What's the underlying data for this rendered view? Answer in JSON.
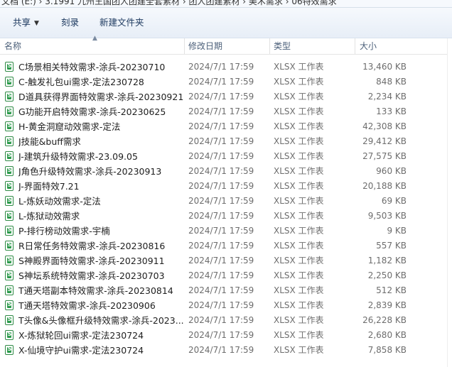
{
  "address": {
    "text": "文档 (E:) › 3.1991 九州王国团人团建全套素材 › 团人团建素材 › 美术需求 › 06特效需求"
  },
  "toolbar": {
    "share_label": "共享",
    "burn_label": "刻录",
    "new_folder_label": "新建文件夹"
  },
  "columns": {
    "name": "名称",
    "date": "修改日期",
    "type": "类型",
    "size": "大小"
  },
  "files": [
    {
      "name": "C场景相关特效需求-涂兵-20230710",
      "date": "2024/7/1 17:59",
      "type": "XLSX 工作表",
      "size": "13,460 KB"
    },
    {
      "name": "C-触发礼包ui需求-定法230728",
      "date": "2024/7/1 17:59",
      "type": "XLSX 工作表",
      "size": "848 KB"
    },
    {
      "name": "D道具获得界面特效需求-涂兵-20230921",
      "date": "2024/7/1 17:59",
      "type": "XLSX 工作表",
      "size": "2,234 KB"
    },
    {
      "name": "G功能开启特效需求-涂兵-20230625",
      "date": "2024/7/1 17:59",
      "type": "XLSX 工作表",
      "size": "133 KB"
    },
    {
      "name": "H-黄金洞窟动效需求-定法",
      "date": "2024/7/1 17:59",
      "type": "XLSX 工作表",
      "size": "42,308 KB"
    },
    {
      "name": "J技能&buff需求",
      "date": "2024/7/1 17:59",
      "type": "XLSX 工作表",
      "size": "29,412 KB"
    },
    {
      "name": "J-建筑升级特效需求-23.09.05",
      "date": "2024/7/1 17:59",
      "type": "XLSX 工作表",
      "size": "27,575 KB"
    },
    {
      "name": "J角色升级特效需求-涂兵-20230913",
      "date": "2024/7/1 17:59",
      "type": "XLSX 工作表",
      "size": "960 KB"
    },
    {
      "name": "J-界面特效7.21",
      "date": "2024/7/1 17:59",
      "type": "XLSX 工作表",
      "size": "20,188 KB"
    },
    {
      "name": "L-炼妖动效需求-定法",
      "date": "2024/7/1 17:59",
      "type": "XLSX 工作表",
      "size": "69 KB"
    },
    {
      "name": "L-炼狱动效需求",
      "date": "2024/7/1 17:59",
      "type": "XLSX 工作表",
      "size": "9,503 KB"
    },
    {
      "name": "P-排行榜动效需求-宇楠",
      "date": "2024/7/1 17:59",
      "type": "XLSX 工作表",
      "size": "9 KB"
    },
    {
      "name": "R日常任务特效需求-涂兵-20230816",
      "date": "2024/7/1 17:59",
      "type": "XLSX 工作表",
      "size": "557 KB"
    },
    {
      "name": "S神殿界面特效需求-涂兵-20230911",
      "date": "2024/7/1 17:59",
      "type": "XLSX 工作表",
      "size": "1,182 KB"
    },
    {
      "name": "S神坛系统特效需求-涂兵-20230703",
      "date": "2024/7/1 17:59",
      "type": "XLSX 工作表",
      "size": "2,250 KB"
    },
    {
      "name": "T通天塔副本特效需求-涂兵-20230814",
      "date": "2024/7/1 17:59",
      "type": "XLSX 工作表",
      "size": "512 KB"
    },
    {
      "name": "T通天塔特效需求-涂兵-20230906",
      "date": "2024/7/1 17:59",
      "type": "XLSX 工作表",
      "size": "2,839 KB"
    },
    {
      "name": "T头像&头像框升级特效需求-涂兵-2023...",
      "date": "2024/7/1 17:59",
      "type": "XLSX 工作表",
      "size": "26,228 KB"
    },
    {
      "name": "X-炼狱轮回ui需求-定法230724",
      "date": "2024/7/1 17:59",
      "type": "XLSX 工作表",
      "size": "2,680 KB"
    },
    {
      "name": "X-仙境守护ui需求-定法230724",
      "date": "2024/7/1 17:59",
      "type": "XLSX 工作表",
      "size": "7,858 KB"
    }
  ]
}
